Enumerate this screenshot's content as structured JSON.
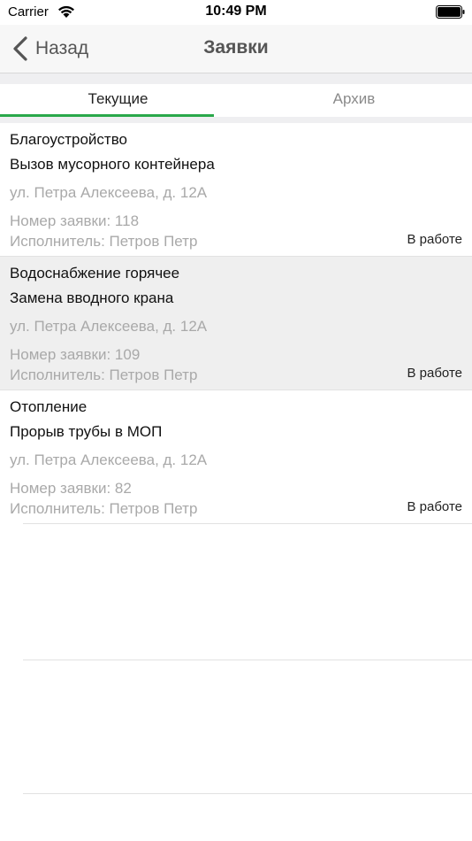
{
  "status_bar": {
    "carrier": "Carrier",
    "time": "10:49 PM",
    "wifi_icon": "wifi-icon",
    "battery_icon": "battery-icon"
  },
  "nav": {
    "back_label": "Назад",
    "back_icon": "chevron-left-icon",
    "title": "Заявки"
  },
  "tabs": [
    {
      "label": "Текущие",
      "active": true
    },
    {
      "label": "Архив",
      "active": false
    }
  ],
  "colors": {
    "accent": "#2aa84a",
    "nav_text": "#555555",
    "secondary_text": "#a9a9a9",
    "selected_row": "#efefef"
  },
  "requests": [
    {
      "category": "Благоустройство",
      "title": "Вызов мусорного контейнера",
      "address": "ул. Петра Алексеева, д. 12А",
      "number": "Номер заявки: 118",
      "executor": "Исполнитель: Петров Петр",
      "status": "В работе",
      "selected": false
    },
    {
      "category": "Водоснабжение горячее",
      "title": "Замена вводного крана",
      "address": "ул. Петра Алексеева, д. 12А",
      "number": "Номер заявки: 109",
      "executor": "Исполнитель: Петров Петр",
      "status": "В работе",
      "selected": true
    },
    {
      "category": "Отопление",
      "title": "Прорыв трубы в МОП",
      "address": "ул. Петра Алексеева, д. 12А",
      "number": "Номер заявки: 82",
      "executor": "Исполнитель: Петров Петр",
      "status": "В работе",
      "selected": false
    }
  ]
}
